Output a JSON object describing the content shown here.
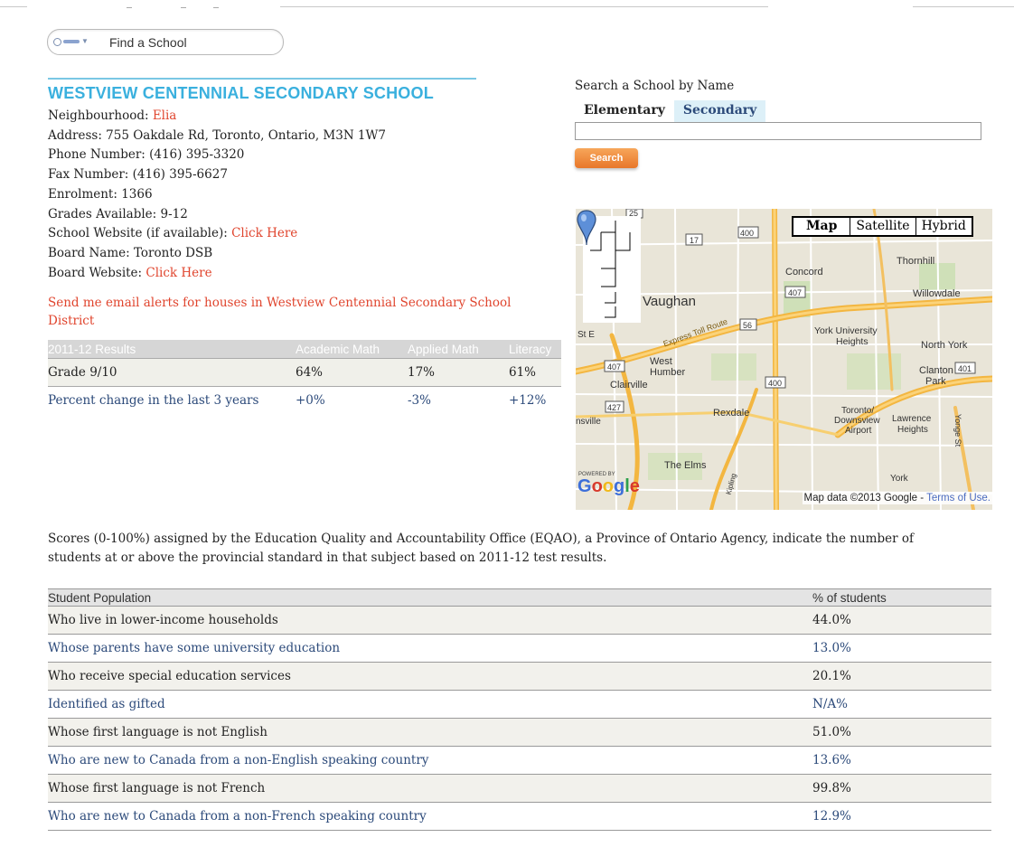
{
  "finder": {
    "placeholder": "Find a School"
  },
  "school": {
    "name": "WESTVIEW CENTENNIAL SECONDARY SCHOOL",
    "neighbourhood_label": "Neighbourhood:",
    "neighbourhood": "Elia",
    "address": "Address: 755 Oakdale Rd, Toronto, Ontario, M3N 1W7",
    "phone": "Phone Number: (416) 395-3320",
    "fax": "Fax Number: (416) 395-6627",
    "enrolment": "Enrolment: 1366",
    "grades": "Grades Available: 9-12",
    "website_label": "School Website (if available):",
    "website_link": "Click Here",
    "board_name": "Board Name: Toronto DSB",
    "board_website_label": "Board Website:",
    "board_website_link": "Click Here",
    "alert_link": "Send me email alerts for houses in Westview Centennial Secondary School District"
  },
  "results": {
    "headers": [
      "2011-12 Results",
      "Academic Math",
      "Applied Math",
      "Literacy"
    ],
    "rows": [
      [
        "Grade 9/10",
        "64%",
        "17%",
        "61%"
      ],
      [
        "Percent change in the last 3 years",
        "+0%",
        "-3%",
        "+12%"
      ]
    ]
  },
  "search": {
    "title": "Search a School by Name",
    "tabs": [
      "Elementary",
      "Secondary"
    ],
    "button": "Search"
  },
  "map": {
    "types": [
      "Map",
      "Satellite",
      "Hybrid"
    ],
    "labels": {
      "vaughan": "Vaughan",
      "concord": "Concord",
      "thornhill": "Thornhill",
      "willowdale": "Willowdale",
      "york_university": "York University",
      "heights": "Heights",
      "north_york": "North York",
      "west": "West",
      "humber": "Humber",
      "clairville": "Clairville",
      "clanton": "Clanton",
      "park": "Park",
      "rexdale": "Rexdale",
      "toronto": "Toronto/",
      "downsview": "Downsview",
      "airport": "Airport",
      "lawrence": "Lawrence",
      "lawrence_heights": "Heights",
      "the_elms": "The Elms",
      "york": "York",
      "sville": "nsville",
      "ste": "St E",
      "toll": "Express Toll Route",
      "yonge": "Yonge St",
      "kipling": "Kipling"
    },
    "shields": [
      "25",
      "17",
      "400",
      "407",
      "56",
      "407",
      "400",
      "427",
      "401"
    ],
    "powered_by": "POWERED BY",
    "google": "Google",
    "attribution": "Map data ©2013 Google -",
    "terms": "Terms of Use."
  },
  "note": "Scores (0-100%) assigned by the Education Quality and Accountability Office (EQAO), a Province of Ontario Agency, indicate the number of students at or above the provincial standard in that subject based on 2011-12 test results.",
  "population": {
    "headers": [
      "Student Population",
      "% of students"
    ],
    "rows": [
      [
        "Who live in lower-income households",
        "44.0%"
      ],
      [
        "Whose parents have some university education",
        "13.0%"
      ],
      [
        "Who receive special education services",
        "20.1%"
      ],
      [
        "Identified as gifted",
        "N/A%"
      ],
      [
        "Whose first language is not English",
        "51.0%"
      ],
      [
        "Who are new to Canada from a non-English speaking country",
        "13.6%"
      ],
      [
        "Whose first language is not French",
        "99.8%"
      ],
      [
        "Who are new to Canada from a non-French speaking country",
        "12.9%"
      ]
    ]
  }
}
